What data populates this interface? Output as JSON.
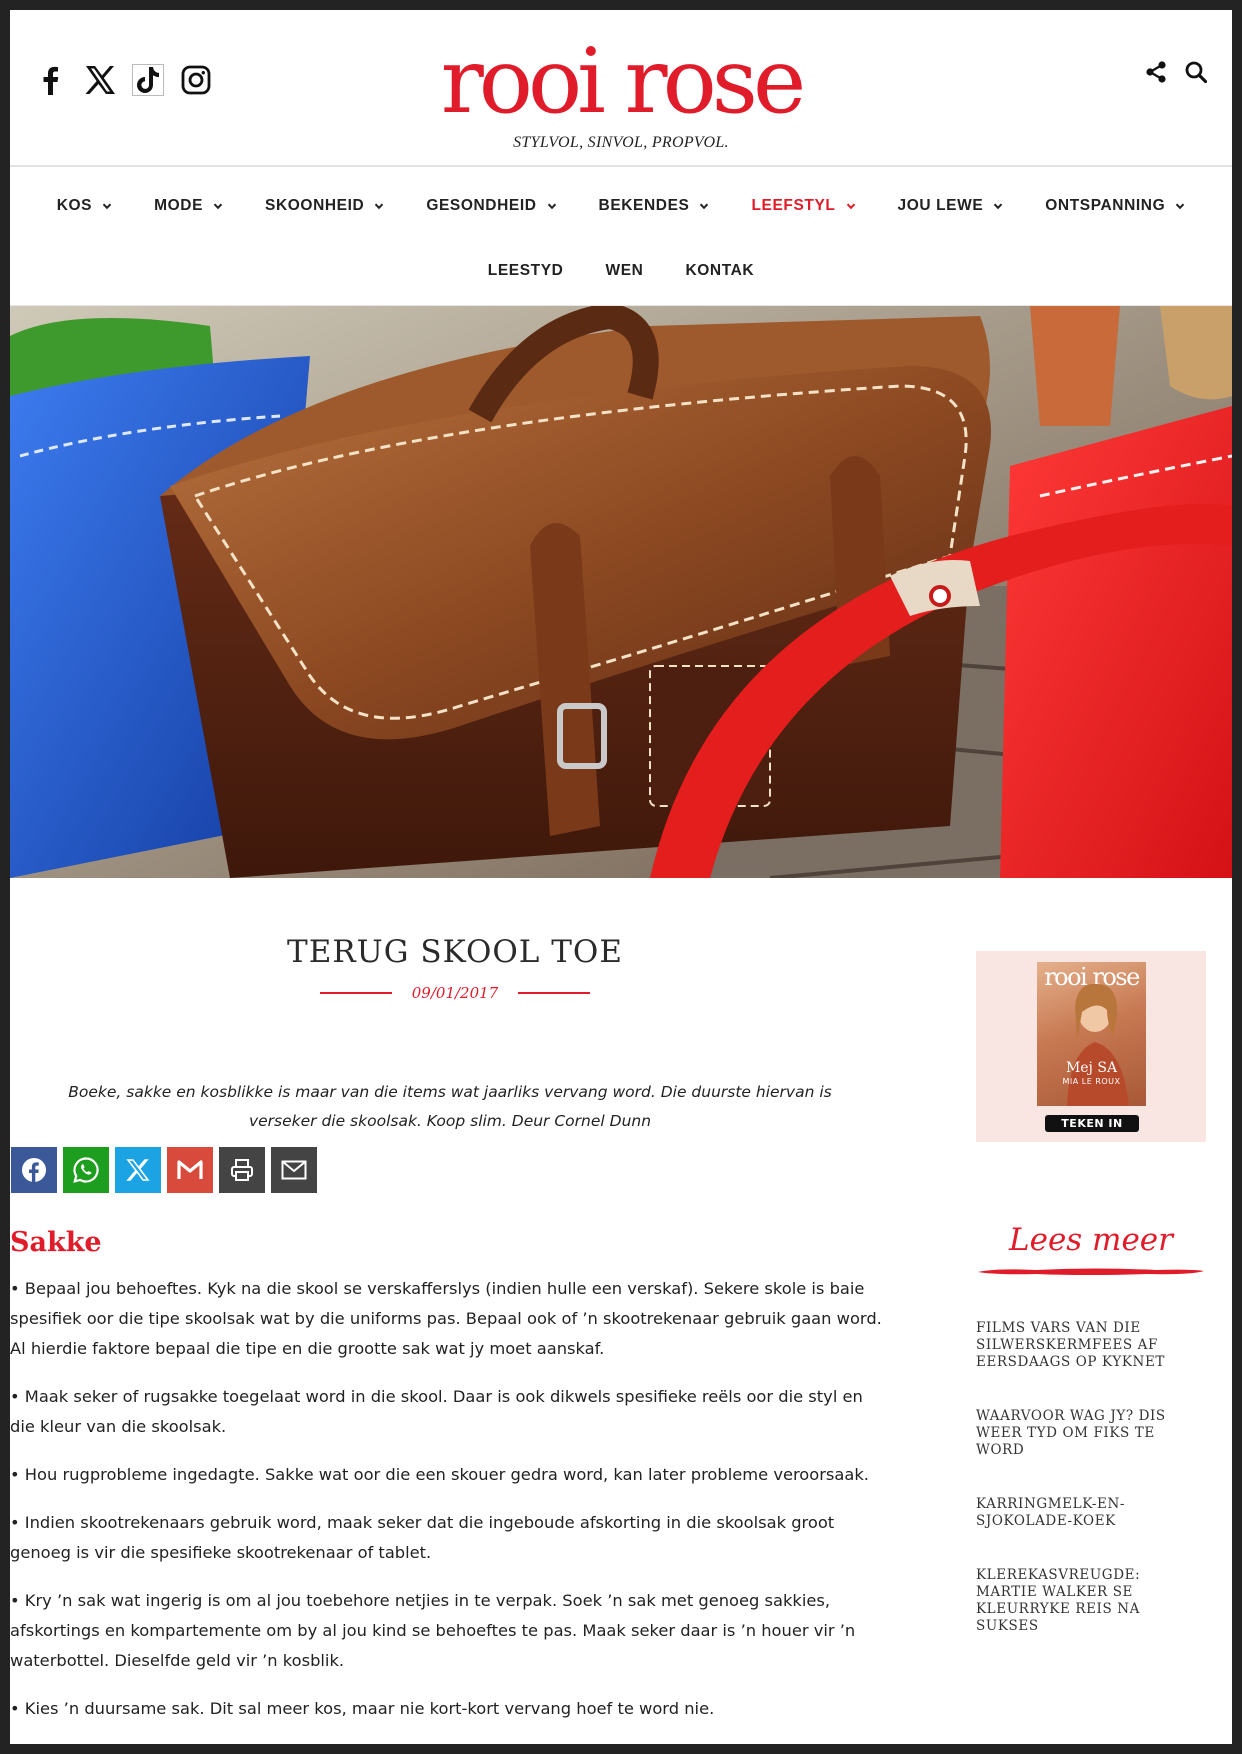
{
  "site": {
    "logo": "rooi rose",
    "tagline": "STYLVOL, SINVOL, PROPVOL."
  },
  "social_icons": [
    "facebook-icon",
    "x-icon",
    "tiktok-icon",
    "instagram-icon"
  ],
  "header_tools": [
    "share-icon",
    "search-icon"
  ],
  "nav": {
    "row1": [
      "KOS",
      "MODE",
      "SKOONHEID",
      "GESONDHEID",
      "BEKENDES",
      "LEEFSTYL",
      "JOU LEWE",
      "ONTSPANNING"
    ],
    "row2": [
      "LEESTYD",
      "WEN",
      "KONTAK"
    ],
    "active": "LEEFSTYL"
  },
  "article": {
    "title": "TERUG SKOOL TOE",
    "date": "09/01/2017",
    "intro": "Boeke, sakke en kosblikke is maar van die items wat jaarliks vervang word. Die duurste hiervan is verseker die skoolsak. Koop slim. Deur Cornel Dunn",
    "section_heading": "Sakke",
    "paragraphs": [
      "• Bepaal jou behoeftes. Kyk na die skool se verskafferslys (indien hulle een verskaf). Sekere skole is baie spesifiek oor die tipe skoolsak wat by die uniforms pas. Bepaal ook of ’n skootrekenaar gebruik gaan word. Al hierdie faktore  bepaal die tipe en die grootte sak wat jy moet aanskaf.",
      "• Maak seker of rugsakke toegelaat word in die skool. Daar is ook dikwels spesifieke reëls oor die styl en die kleur van die skoolsak.",
      "• Hou rugprobleme ingedagte. Sakke wat oor die een skouer gedra word, kan later probleme veroorsaak.",
      "• Indien skootrekenaars gebruik word, maak seker dat die ingeboude afskorting in die skoolsak groot genoeg is vir die spesifieke skootrekenaar of tablet.",
      "• Kry ’n sak wat ingerig is om al jou toebehore netjies in te verpak. Soek ’n sak met genoeg sakkies, afskortings en kompartemente om by al jou kind se behoeftes te pas. Maak seker daar is ’n houer vir ’n waterbottel. Dieselfde geld vir ’n kosblik.",
      "• Kies ’n duursame sak. Dit sal meer kos, maar nie kort-kort vervang hoef te word nie."
    ]
  },
  "share_buttons": [
    {
      "icon": "facebook-icon",
      "color": "#3b5998"
    },
    {
      "icon": "whatsapp-icon",
      "color": "#1e9e1e"
    },
    {
      "icon": "x-icon",
      "color": "#1ba3e3"
    },
    {
      "icon": "gmail-icon",
      "color": "#d84b3c"
    },
    {
      "icon": "print-icon",
      "color": "#444444"
    },
    {
      "icon": "email-icon",
      "color": "#444444"
    }
  ],
  "sidebar": {
    "magazine": {
      "logo": "rooi rose",
      "cover_name": "Mej SA",
      "cover_subname": "MIA LE ROUX",
      "button": "TEKEN IN"
    },
    "lees_meer": "Lees meer",
    "related": [
      "FILMS VARS VAN DIE SILWERSKERMFEES AF EERSDAAGS OP KYKNET",
      "WAARVOOR WAG JY? DIS WEER TYD OM FIKS TE WORD",
      "KARRINGMELK-EN-SJOKOLADE-KOEK",
      "KLEREKASVREUGDE: MARTIE WALKER SE KLEURRYKE REIS NA SUKSES"
    ]
  },
  "colors": {
    "brand_red": "#e01b2a",
    "text": "#222222",
    "sidebar_box": "#f9e6e3"
  }
}
